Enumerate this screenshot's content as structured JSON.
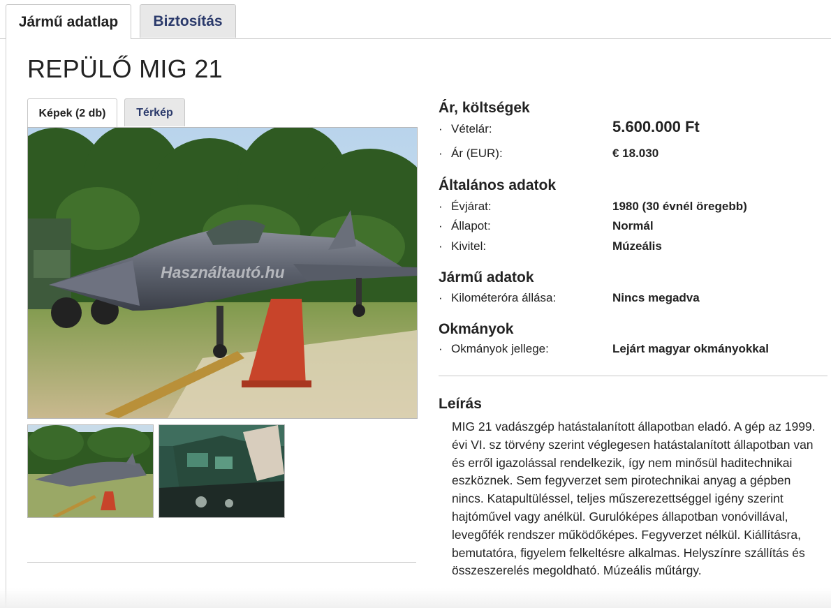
{
  "tabs": {
    "active": "Jármű adatlap",
    "inactive": "Biztosítás"
  },
  "title": "REPÜLŐ MIG 21",
  "media_tabs": {
    "photos": "Képek (2 db)",
    "map": "Térkép"
  },
  "watermark": "Használtautó.hu",
  "price_section": {
    "heading": "Ár, költségek",
    "rows": [
      {
        "label": "Vételár:",
        "value": "5.600.000 Ft"
      },
      {
        "label": "Ár (EUR):",
        "value": "€ 18.030"
      }
    ]
  },
  "general_section": {
    "heading": "Általános adatok",
    "rows": [
      {
        "label": "Évjárat:",
        "value": "1980 (30 évnél öregebb)"
      },
      {
        "label": "Állapot:",
        "value": "Normál"
      },
      {
        "label": "Kivitel:",
        "value": "Múzeális"
      }
    ]
  },
  "vehicle_section": {
    "heading": "Jármű adatok",
    "rows": [
      {
        "label": "Kilométeróra állása:",
        "value": "Nincs megadva"
      }
    ]
  },
  "docs_section": {
    "heading": "Okmányok",
    "rows": [
      {
        "label": "Okmányok jellege:",
        "value": "Lejárt magyar okmányokkal"
      }
    ]
  },
  "description": {
    "heading": "Leírás",
    "text": "MIG 21 vadászgép hatástalanított állapotban eladó. A gép az 1999. évi VI. sz törvény szerint véglegesen hatástalanított állapotban van és erről igazolással rendelkezik, így nem minősül haditechnikai eszköznek. Sem fegyverzet sem pirotechnikai anyag a gépben nincs. Katapultüléssel, teljes műszerezettséggel igény szerint hajtóművel vagy anélkül. Gurulóképes állapotban vonóvillával, levegőfék rendszer működőképes. Fegyverzet nélkül. Kiállításra, bemutatóra, figyelem felkeltésre alkalmas. Helyszínre szállítás és összeszerelés megoldható. Múzeális műtárgy."
  }
}
